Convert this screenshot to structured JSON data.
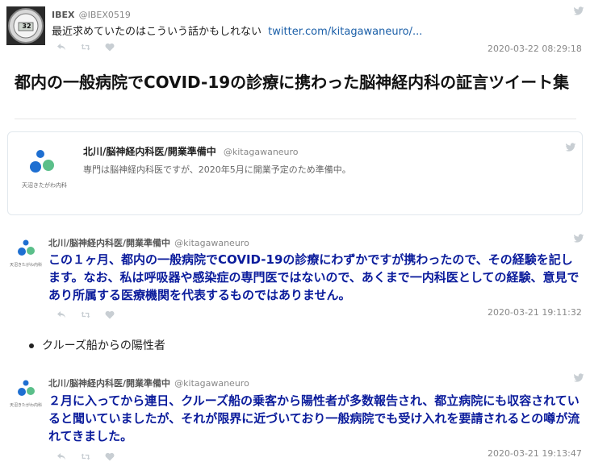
{
  "tweet1": {
    "name": "IBEX",
    "handle": "@IBEX0519",
    "avatar_text": "32",
    "text": "最近求めていたのはこういう話かもしれない",
    "link": "twitter.com/kitagawaneuro/...",
    "timestamp": "2020-03-22 08:29:18"
  },
  "article": {
    "title": "都内の一般病院でCOVID-19の診療に携わった脳神経内科の証言ツイート集"
  },
  "profile_card": {
    "name": "北川/脳神経内科医/開業準備中",
    "handle": "@kitagawaneuro",
    "bio": "専門は脳神経内科医ですが、2020年5月に開業予定のため準備中。",
    "logo_text": "天沼きたがわ内科"
  },
  "tweet2": {
    "name": "北川/脳神経内科医/開業準備中",
    "handle": "@kitagawaneuro",
    "text": "この１ヶ月、都内の一般病院でCOVID-19の診療にわずかですが携わったので、その経験を記します。なお、私は呼吸器や感染症の専門医ではないので、あくまで一内科医としての経験、意見であり所属する医療機関を代表するものではありません。",
    "timestamp": "2020-03-21 19:11:32"
  },
  "bullet": {
    "text": "クルーズ船からの陽性者"
  },
  "tweet3": {
    "name": "北川/脳神経内科医/開業準備中",
    "handle": "@kitagawaneuro",
    "text": "２月に入ってから連日、クルーズ船の乗客から陽性者が多数報告され、都立病院にも収容されていると聞いていましたが、それが限界に近づいており一般病院でも受け入れを要請されるとの噂が流れてきました。",
    "timestamp": "2020-03-21 19:13:47"
  },
  "colors": {
    "body_text_blue": "#0b1c9c",
    "link_blue": "#1b5fa8",
    "logo_blue": "#1e6fd1",
    "logo_green": "#5bbf8a"
  },
  "icons": [
    "twitter-bird-icon",
    "reply-icon",
    "retweet-icon",
    "like-icon"
  ]
}
